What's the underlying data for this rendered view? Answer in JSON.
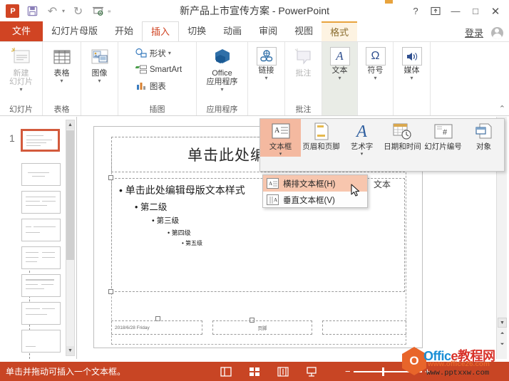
{
  "window": {
    "title": "新产品上市宣传方案 - PowerPoint",
    "app_logo": "powerpoint-logo",
    "controls": {
      "help": "?",
      "ribbon_display": "ribbon-display-options",
      "minimize": "—",
      "maximize": "□",
      "close": "✕"
    }
  },
  "quick_access": [
    {
      "name": "save-icon",
      "glyph": "▤"
    },
    {
      "name": "undo-icon",
      "glyph": "↶"
    },
    {
      "name": "redo-icon",
      "glyph": "↷"
    },
    {
      "name": "start-slideshow-icon",
      "glyph": "▭"
    },
    {
      "name": "customize-qat-icon",
      "glyph": "▾"
    }
  ],
  "tabs": [
    {
      "label": "文件",
      "state": "file"
    },
    {
      "label": "幻灯片母版",
      "state": "normal"
    },
    {
      "label": "开始",
      "state": "normal"
    },
    {
      "label": "插入",
      "state": "active"
    },
    {
      "label": "切换",
      "state": "normal"
    },
    {
      "label": "动画",
      "state": "normal"
    },
    {
      "label": "审阅",
      "state": "normal"
    },
    {
      "label": "视图",
      "state": "normal"
    },
    {
      "label": "格式",
      "state": "contextual"
    }
  ],
  "signin_label": "登录",
  "ribbon": {
    "groups": [
      {
        "name": "slides",
        "label": "幻灯片",
        "buttons": [
          {
            "name": "new-slide-button",
            "line1": "新建",
            "line2": "幻灯片",
            "caret": "▾",
            "dim": true
          }
        ]
      },
      {
        "name": "tables",
        "label": "表格",
        "buttons": [
          {
            "name": "table-button",
            "line1": "表格",
            "line2": "",
            "caret": "▾",
            "dim": false
          }
        ]
      },
      {
        "name": "images",
        "label": "",
        "buttons": [
          {
            "name": "images-button",
            "line1": "图像",
            "line2": "",
            "caret": "▾",
            "dim": false
          }
        ]
      },
      {
        "name": "illustrations",
        "label": "插图",
        "small_buttons": [
          {
            "name": "shapes-button",
            "label": "形状",
            "caret": "▾"
          },
          {
            "name": "smartart-button",
            "label": "SmartArt",
            "caret": ""
          },
          {
            "name": "chart-button",
            "label": "图表",
            "caret": ""
          }
        ]
      },
      {
        "name": "apps",
        "label": "应用程序",
        "buttons": [
          {
            "name": "office-apps-button",
            "line1": "Office",
            "line2": "应用程序",
            "caret": "▾",
            "dim": false
          }
        ]
      },
      {
        "name": "links",
        "label": "",
        "buttons": [
          {
            "name": "link-button",
            "line1": "链接",
            "line2": "",
            "caret": "▾",
            "dim": false
          }
        ]
      },
      {
        "name": "comments",
        "label": "批注",
        "buttons": [
          {
            "name": "comment-button",
            "line1": "批注",
            "line2": "",
            "caret": "",
            "dim": true
          }
        ]
      },
      {
        "name": "text",
        "label": "",
        "highlighted": true,
        "buttons": [
          {
            "name": "text-button",
            "line1": "文本",
            "line2": "",
            "caret": "▾",
            "dim": false
          }
        ]
      },
      {
        "name": "symbols",
        "label": "",
        "buttons": [
          {
            "name": "symbols-button",
            "line1": "符号",
            "line2": "",
            "caret": "▾",
            "dim": false
          }
        ]
      },
      {
        "name": "media",
        "label": "",
        "buttons": [
          {
            "name": "media-button",
            "line1": "媒体",
            "line2": "",
            "caret": "▾",
            "dim": false
          }
        ]
      }
    ],
    "collapse_glyph": "⌃"
  },
  "text_gallery": {
    "items": [
      {
        "name": "text-box-gallery-item",
        "label": "文本框",
        "caret": "▾",
        "selected": true
      },
      {
        "name": "header-footer-gallery-item",
        "label": "页眉和页脚",
        "caret": "",
        "selected": false
      },
      {
        "name": "wordart-gallery-item",
        "label": "艺术字",
        "caret": "▾",
        "selected": false
      },
      {
        "name": "date-time-gallery-item",
        "label": "日期和时间",
        "caret": "",
        "selected": false
      },
      {
        "name": "slide-number-gallery-item",
        "label": "幻灯片编号",
        "caret": "",
        "selected": false
      },
      {
        "name": "object-gallery-item",
        "label": "对象",
        "caret": "",
        "selected": false
      }
    ],
    "group_label": "文本"
  },
  "text_box_submenu": {
    "items": [
      {
        "name": "horizontal-text-box-menu-item",
        "label": "横排文本框(H)",
        "highlighted": true
      },
      {
        "name": "vertical-text-box-menu-item",
        "label": "垂直文本框(V)",
        "highlighted": false
      }
    ]
  },
  "thumbnails": {
    "selected_number": "1",
    "count": 8
  },
  "slide": {
    "title_placeholder": "单击此处编辑母版标",
    "body_levels": [
      "• 单击此处编辑母版文本样式",
      "• 第二级",
      "• 第三级",
      "• 第四级",
      "• 第五级"
    ],
    "footers": {
      "date": "2018/6/28 Friday",
      "footer": "页脚",
      "slide_number": ""
    }
  },
  "status_bar": {
    "message": "单击并拖动可插入一个文本框。",
    "views": [
      {
        "name": "normal-view-icon"
      },
      {
        "name": "slide-sorter-view-icon"
      },
      {
        "name": "reading-view-icon"
      },
      {
        "name": "slideshow-view-icon"
      }
    ],
    "zoom": {
      "minus": "−",
      "plus": "+"
    }
  },
  "watermark": {
    "logo_letter": "O",
    "brand_en": "Offic",
    "brand_cn": "e教程网",
    "url_top": "www.office26.com",
    "url_bottom": "www.pptxxw.com"
  }
}
